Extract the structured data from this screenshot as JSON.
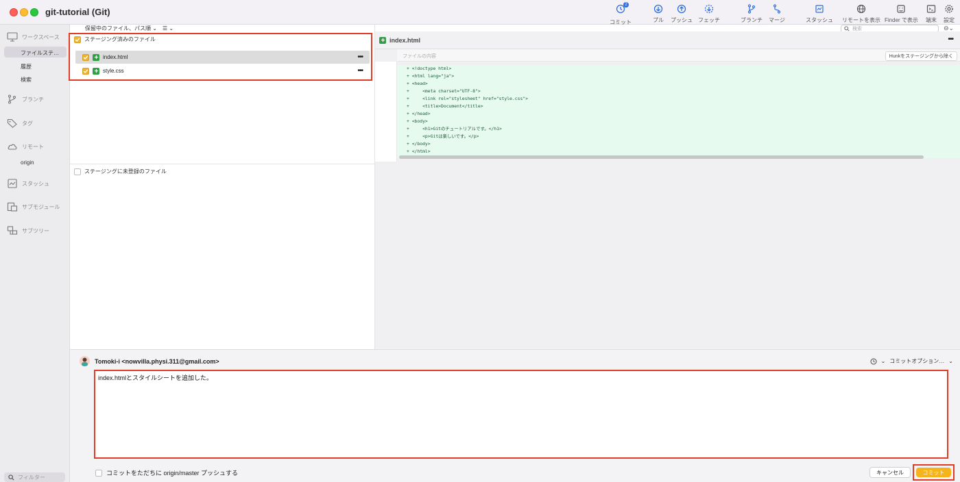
{
  "window": {
    "title": "git-tutorial (Git)"
  },
  "toolbar": {
    "commit": "コミット",
    "commit_badge": "2",
    "pull": "プル",
    "push": "プッシュ",
    "fetch": "フェッチ",
    "branch": "ブランチ",
    "merge": "マージ",
    "stash": "スタッシュ",
    "show_remote": "リモートを表示",
    "show_in_finder": "Finder で表示",
    "terminal": "端末",
    "settings": "設定",
    "search_placeholder": "検索",
    "search_option": "⊖⌄"
  },
  "sidebar": {
    "workspace": "ワークスペース",
    "file_status": "ファイルステ…",
    "history": "履歴",
    "search": "検索",
    "branches": "ブランチ",
    "tags": "タグ",
    "remotes": "リモート",
    "remote_origin": "origin",
    "stashes": "スタッシュ",
    "submodules": "サブモジュール",
    "subtrees": "サブツリー",
    "filter_placeholder": "フィルター"
  },
  "filelist": {
    "sort_label": "保留中のファイル、パス順 ⌄",
    "view_icon": "☰ ⌄",
    "staged_title": "ステージング済みのファイル",
    "staged_files": [
      {
        "name": "index.html",
        "menu": "•••"
      },
      {
        "name": "style.css",
        "menu": "•••"
      }
    ],
    "unstaged_title": "ステージングに未登録のファイル"
  },
  "diff": {
    "file_name": "index.html",
    "menu": "•••",
    "hunk_title": "ファイルの内容",
    "hunk_button": "Hunkをステージングから除く",
    "lines": [
      "+ <!doctype html>",
      "+ <html lang=\"ja\">",
      "+ <head>",
      "+     <meta charset=\"UTF-8\">",
      "+     <link rel=\"stylesheet\" href=\"style.css\">",
      "+     <title>Document</title>",
      "+ </head>",
      "+ <body>",
      "+     <h1>Gitのチュートリアルです。</h1>",
      "+     <p>Gitは楽しいです。</p>",
      "+ </body>",
      "+ </html>"
    ]
  },
  "commit": {
    "author": "Tomoki-i <nowvilla.physi.311@gmail.com>",
    "options_label": "コミットオプション…",
    "message": "index.htmlとスタイルシートを追加した。",
    "push_immediately": "コミットをただちに origin/master プッシュする",
    "cancel": "キャンセル",
    "commit_button": "コミット"
  },
  "colors": {
    "highlight": "#e03b24",
    "commit_button": "#f5b31c",
    "added_line_bg": "#e6faf0",
    "added_icon": "#2f9e44",
    "checkbox": "#f0b429"
  }
}
